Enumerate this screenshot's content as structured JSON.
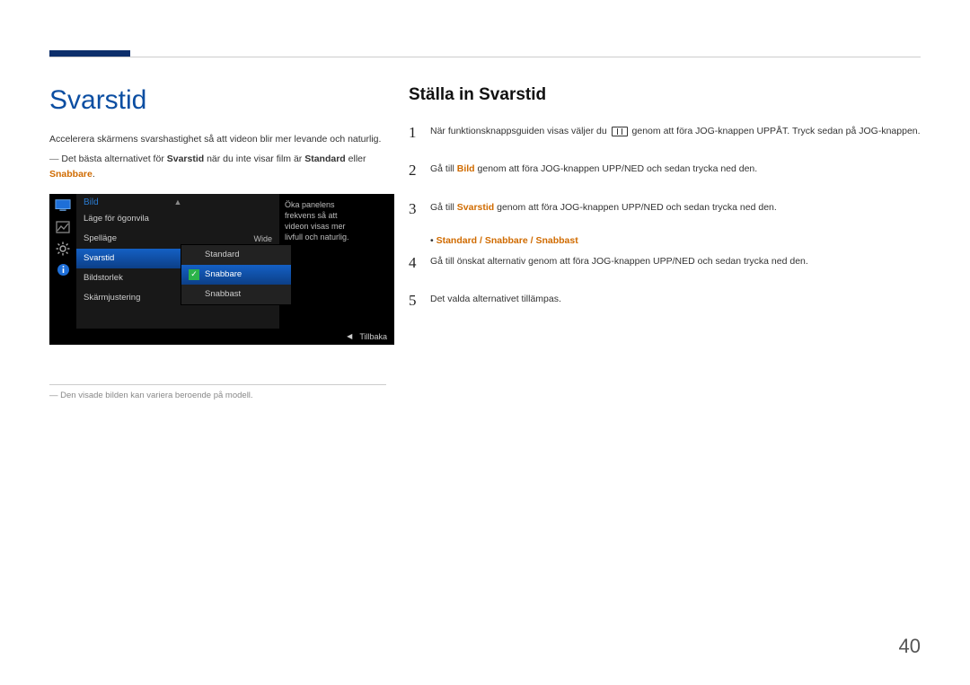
{
  "page_number": "40",
  "left": {
    "heading": "Svarstid",
    "intro": "Accelerera skärmens svarshastighet så att videon blir mer levande och naturlig.",
    "note_prefix": "Det bästa alternativet för ",
    "note_bold1": "Svarstid",
    "note_mid": " när du inte visar film är ",
    "note_bold2": "Standard",
    "note_mid2": " eller ",
    "note_highlight": "Snabbare",
    "note_suffix": ".",
    "footnote": "Den visade bilden kan variera beroende på modell."
  },
  "osd": {
    "title": "Bild",
    "items": [
      {
        "label": "Läge för ögonvila",
        "value": ""
      },
      {
        "label": "Spelläge",
        "value": "Wide"
      },
      {
        "label": "Svarstid",
        "value": ""
      },
      {
        "label": "Bildstorlek",
        "value": ""
      },
      {
        "label": "Skärmjustering",
        "value": ""
      }
    ],
    "submenu": {
      "options": [
        "Standard",
        "Snabbare",
        "Snabbast"
      ],
      "selected": "Snabbare"
    },
    "side_text": "Öka panelens frekvens så att videon visas mer livfull och naturlig.",
    "action_label": "Tillbaka"
  },
  "right": {
    "heading": "Ställa in Svarstid",
    "step1_a": "När funktionsknappsguiden visas väljer du ",
    "step1_b": " genom att föra JOG-knappen UPPÅT. Tryck sedan på JOG-knappen.",
    "step2_a": "Gå till ",
    "step2_bold": "Bild",
    "step2_b": " genom att föra JOG-knappen UPP/NED och sedan trycka ned den.",
    "step3_a": "Gå till ",
    "step3_bold": "Svarstid",
    "step3_b": " genom att föra JOG-knappen UPP/NED och sedan trycka ned den.",
    "options_line": "Standard / Snabbare / Snabbast",
    "step4": "Gå till önskat alternativ genom att föra JOG-knappen UPP/NED och sedan trycka ned den.",
    "step5": "Det valda alternativet tillämpas."
  }
}
